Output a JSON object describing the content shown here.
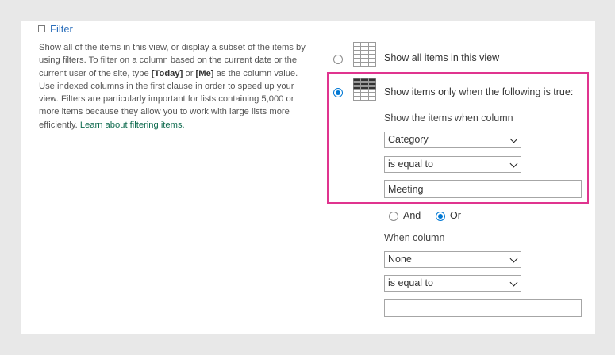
{
  "section": {
    "title": "Filter"
  },
  "description": {
    "text_1": "Show all of the items in this view, or display a subset of the items by using filters. To filter on a column based on the current date or the current user of the site, type ",
    "today_token": "[Today]",
    "text_or": " or ",
    "me_token": "[Me]",
    "text_2": " as the column value. Use indexed columns in the first clause in order to speed up your view. Filters are particularly important for lists containing 5,000 or more items because they allow you to work with large lists more efficiently. ",
    "link": "Learn about filtering items."
  },
  "options": {
    "show_all": {
      "label": "Show all items in this view",
      "selected": false
    },
    "show_filtered": {
      "label": "Show items only when the following is true:",
      "selected": true
    }
  },
  "clause1": {
    "heading": "Show the items when column",
    "column": "Category",
    "operator": "is equal to",
    "value": "Meeting"
  },
  "join": {
    "and_label": "And",
    "or_label": "Or",
    "selected": "Or"
  },
  "clause2": {
    "heading": "When column",
    "column": "None",
    "operator": "is equal to",
    "value": ""
  },
  "colors": {
    "highlight": "#e0348f",
    "accent": "#0078d4",
    "link": "#0f6b4f",
    "section_title": "#2a6ebb"
  }
}
